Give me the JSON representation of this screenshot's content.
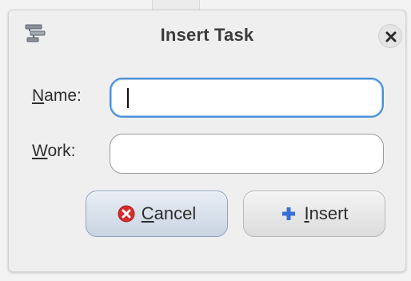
{
  "dialog": {
    "title": "Insert Task",
    "app_icon": "task-list-icon",
    "close_icon": "close-icon"
  },
  "fields": {
    "name": {
      "label_mnemonic": "N",
      "label_rest": "ame:",
      "value": "",
      "placeholder": ""
    },
    "work": {
      "label_mnemonic": "W",
      "label_rest": "ork:",
      "value": "",
      "placeholder": ""
    }
  },
  "buttons": {
    "cancel": {
      "label_mnemonic": "C",
      "label_rest": "ancel",
      "icon": "cancel-icon",
      "icon_color": "#d62b2b"
    },
    "insert": {
      "label_mnemonic": "I",
      "label_rest": "nsert",
      "icon": "plus-icon",
      "icon_color": "#3a6fd8"
    }
  },
  "colors": {
    "focus_border": "#4a90d9"
  }
}
